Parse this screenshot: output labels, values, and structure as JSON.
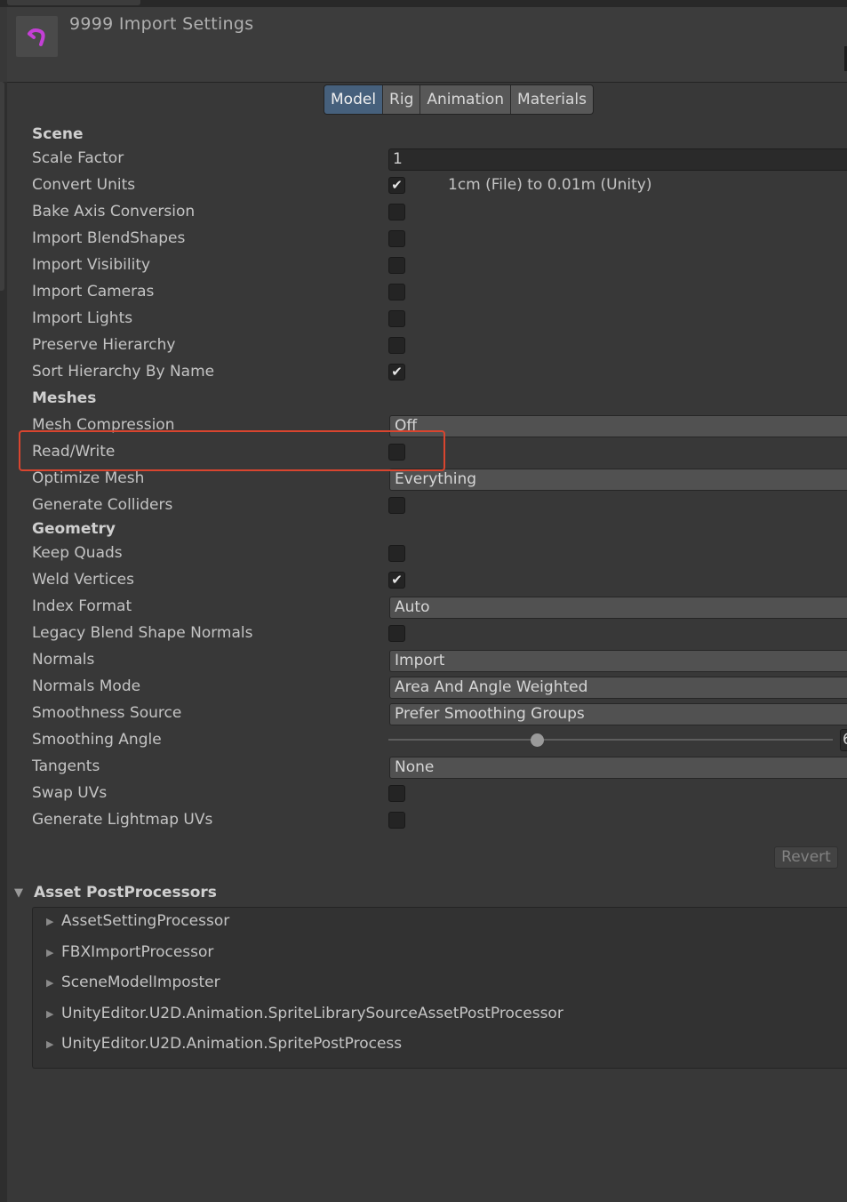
{
  "header": {
    "title": "9999 Import Settings",
    "icon": "fbx-asset-icon"
  },
  "tabs": [
    "Model",
    "Rig",
    "Animation",
    "Materials"
  ],
  "active_tab": "Model",
  "scene": {
    "heading": "Scene",
    "scale_factor": {
      "label": "Scale Factor",
      "value": "1"
    },
    "convert_units": {
      "label": "Convert Units",
      "checked": true,
      "note": "1cm (File) to 0.01m (Unity)"
    },
    "bake_axis": {
      "label": "Bake Axis Conversion",
      "checked": false
    },
    "blendshapes": {
      "label": "Import BlendShapes",
      "checked": false
    },
    "visibility": {
      "label": "Import Visibility",
      "checked": false
    },
    "cameras": {
      "label": "Import Cameras",
      "checked": false
    },
    "lights": {
      "label": "Import Lights",
      "checked": false
    },
    "preserve_hierarchy": {
      "label": "Preserve Hierarchy",
      "checked": false
    },
    "sort_hierarchy": {
      "label": "Sort Hierarchy By Name",
      "checked": true
    }
  },
  "meshes": {
    "heading": "Meshes",
    "compression": {
      "label": "Mesh Compression",
      "value": "Off"
    },
    "read_write": {
      "label": "Read/Write",
      "checked": false
    },
    "optimize": {
      "label": "Optimize Mesh",
      "value": "Everything"
    },
    "colliders": {
      "label": "Generate Colliders",
      "checked": false
    }
  },
  "geometry": {
    "heading": "Geometry",
    "keep_quads": {
      "label": "Keep Quads",
      "checked": false
    },
    "weld_vertices": {
      "label": "Weld Vertices",
      "checked": true
    },
    "index_format": {
      "label": "Index Format",
      "value": "Auto"
    },
    "legacy_normals": {
      "label": "Legacy Blend Shape Normals",
      "checked": false
    },
    "normals": {
      "label": "Normals",
      "value": "Import"
    },
    "normals_mode": {
      "label": "Normals Mode",
      "value": "Area And Angle Weighted"
    },
    "smoothness_source": {
      "label": "Smoothness Source",
      "value": "Prefer Smoothing Groups"
    },
    "smoothing_angle": {
      "label": "Smoothing Angle",
      "value_visible": "6",
      "fraction": 0.34
    },
    "tangents": {
      "label": "Tangents",
      "value": "None"
    },
    "swap_uvs": {
      "label": "Swap UVs",
      "checked": false
    },
    "lightmap_uvs": {
      "label": "Generate Lightmap UVs",
      "checked": false
    }
  },
  "revert_label": "Revert",
  "postprocessors": {
    "heading": "Asset PostProcessors",
    "items": [
      "AssetSettingProcessor",
      "FBXImportProcessor",
      "SceneModelImposter",
      "UnityEditor.U2D.Animation.SpriteLibrarySourceAssetPostProcessor",
      "UnityEditor.U2D.Animation.SpritePostProcess"
    ]
  },
  "colors": {
    "background": "#383838",
    "active_tab": "#46607c",
    "highlight": "#d9452f",
    "icon_accent": "#c43fd6"
  }
}
